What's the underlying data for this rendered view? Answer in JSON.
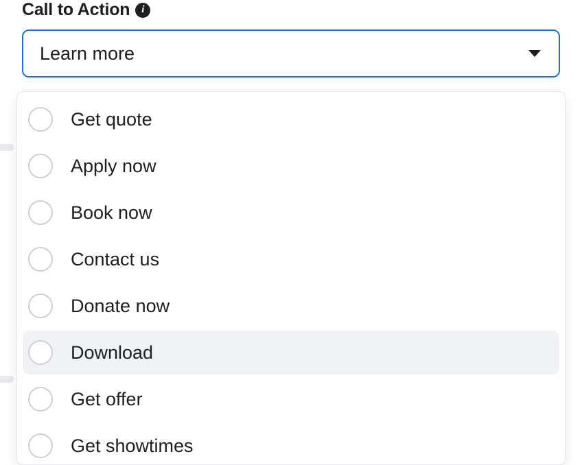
{
  "field": {
    "label": "Call to Action",
    "info_icon_glyph": "i",
    "selected_value": "Learn more"
  },
  "options": [
    {
      "label": "Get quote",
      "hovered": false
    },
    {
      "label": "Apply now",
      "hovered": false
    },
    {
      "label": "Book now",
      "hovered": false
    },
    {
      "label": "Contact us",
      "hovered": false
    },
    {
      "label": "Donate now",
      "hovered": false
    },
    {
      "label": "Download",
      "hovered": true
    },
    {
      "label": "Get offer",
      "hovered": false
    },
    {
      "label": "Get showtimes",
      "hovered": false
    }
  ]
}
